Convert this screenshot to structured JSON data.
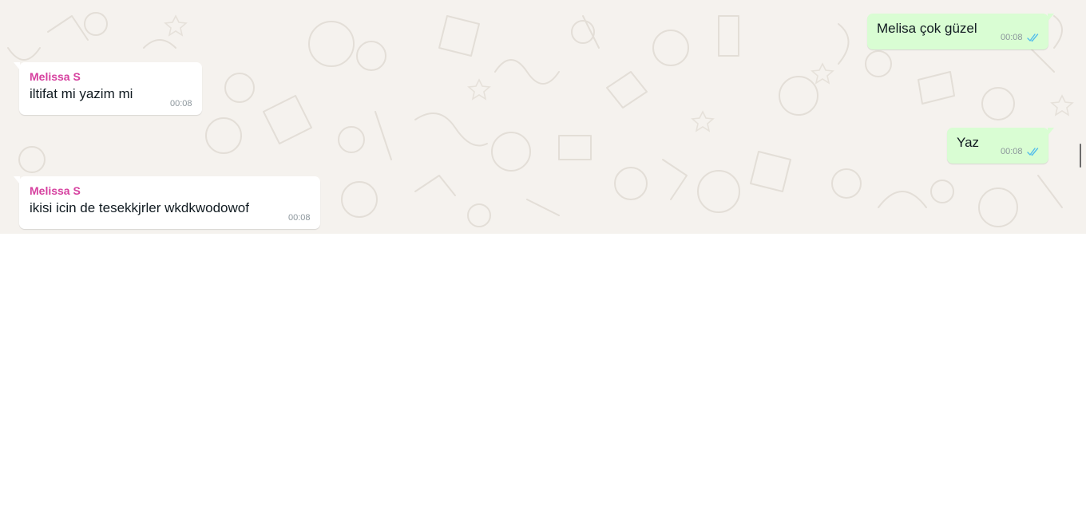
{
  "colors": {
    "chat_background": "#f5f2ee",
    "incoming_bubble": "#ffffff",
    "outgoing_bubble": "#d9fdd3",
    "sender_name": "#d6409f",
    "read_ticks": "#53bdeb"
  },
  "messages": [
    {
      "direction": "outgoing",
      "text": "Melisa çok güzel",
      "time": "00:08",
      "status_icon": "double-check-read-icon"
    },
    {
      "direction": "incoming",
      "sender": "Melissa S",
      "text": "iltifat mi yazim mi",
      "time": "00:08"
    },
    {
      "direction": "outgoing",
      "text": "Yaz",
      "time": "00:08",
      "status_icon": "double-check-read-icon"
    },
    {
      "direction": "incoming",
      "sender": "Melissa S",
      "text": "ikisi icin de tesekkjrler wkdkwodowof",
      "time": "00:08"
    }
  ]
}
